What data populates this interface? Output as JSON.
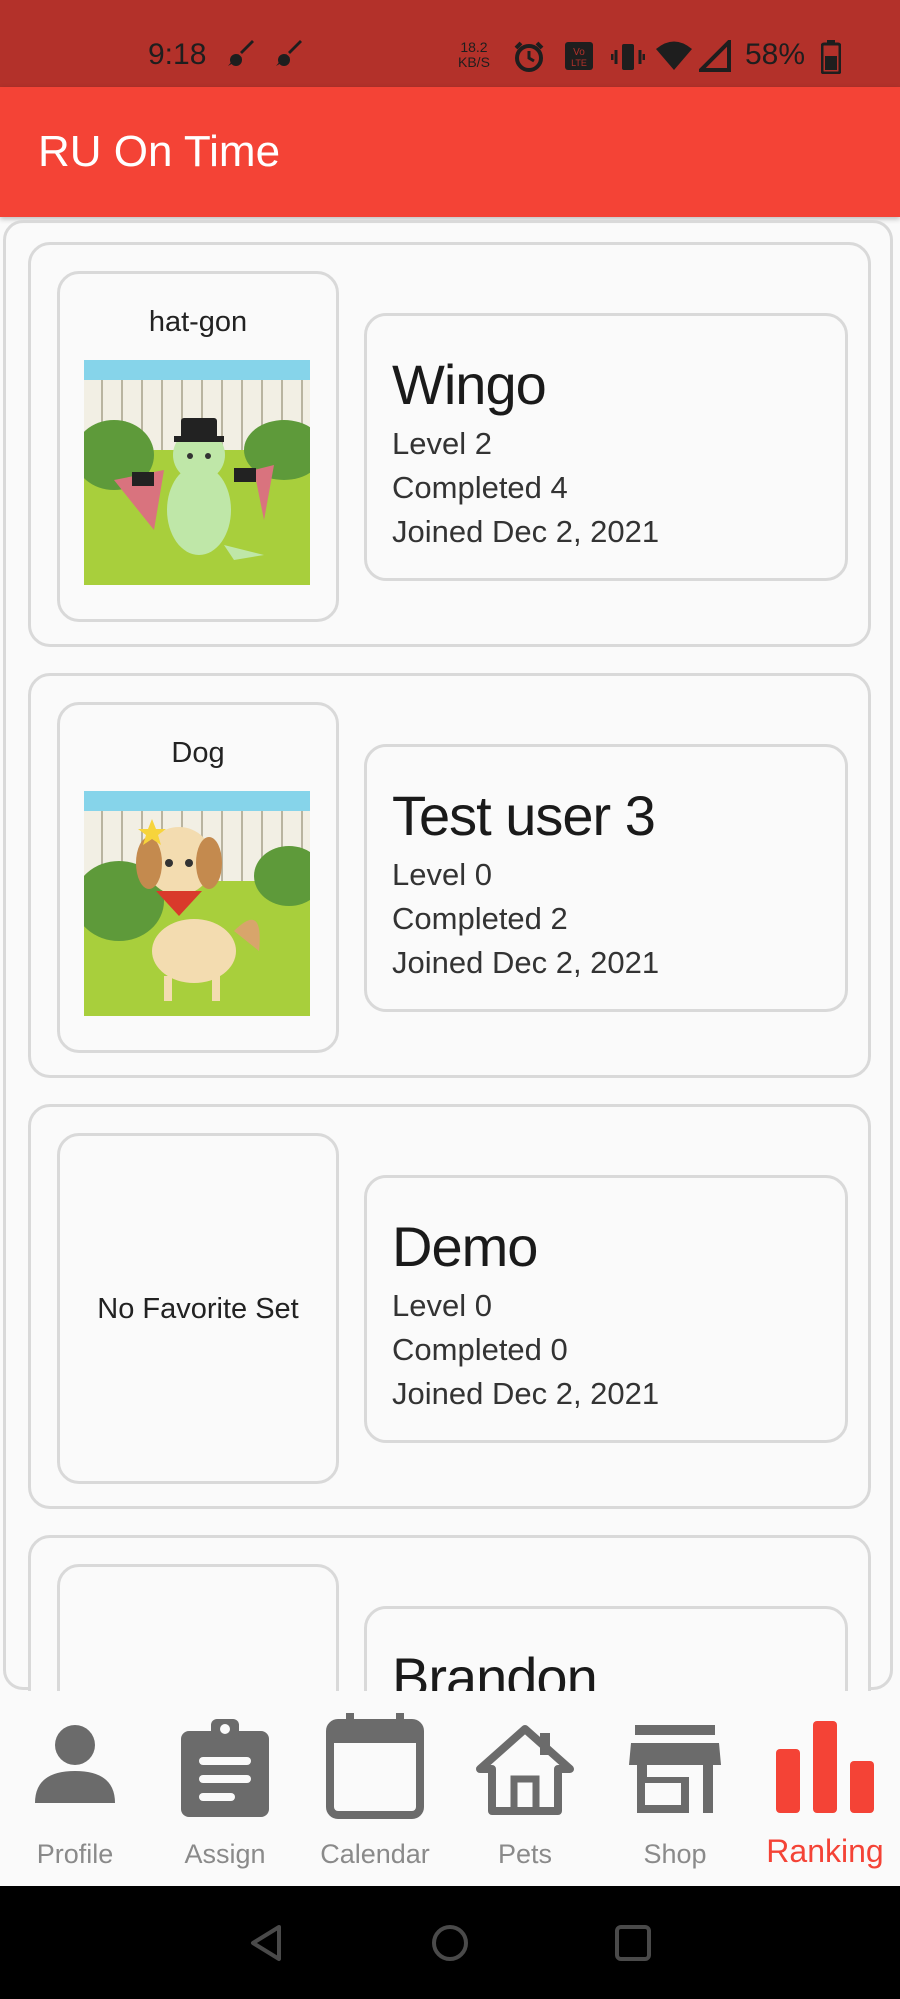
{
  "status_bar": {
    "time": "9:18",
    "net_speed_value": "18.2",
    "net_speed_unit": "KB/S",
    "battery_percent": "58%",
    "color": "#b3312a"
  },
  "app_bar": {
    "title": "RU On Time",
    "color": "#f44336"
  },
  "rankings": [
    {
      "pet_label": "hat-gon",
      "name": "Wingo",
      "level": "Level 2",
      "completed": "Completed 4",
      "joined": "Joined Dec 2, 2021"
    },
    {
      "pet_label": "Dog",
      "name": "Test user 3",
      "level": "Level 0",
      "completed": "Completed 2",
      "joined": "Joined Dec 2, 2021"
    },
    {
      "pet_label": "No Favorite Set",
      "name": "Demo",
      "level": "Level 0",
      "completed": "Completed 0",
      "joined": "Joined Dec 2, 2021"
    },
    {
      "pet_label": "",
      "name": "Brandon"
    }
  ],
  "bottom_nav": [
    {
      "label": "Profile",
      "icon": "person-icon"
    },
    {
      "label": "Assign",
      "icon": "clipboard-icon"
    },
    {
      "label": "Calendar",
      "icon": "calendar-icon"
    },
    {
      "label": "Pets",
      "icon": "house-icon"
    },
    {
      "label": "Shop",
      "icon": "store-icon"
    },
    {
      "label": "Ranking",
      "icon": "bar-chart-icon",
      "active": true
    }
  ],
  "colors": {
    "accent": "#f44336",
    "inactive_icon": "#6b6b6b",
    "border": "#d9d9d9"
  }
}
